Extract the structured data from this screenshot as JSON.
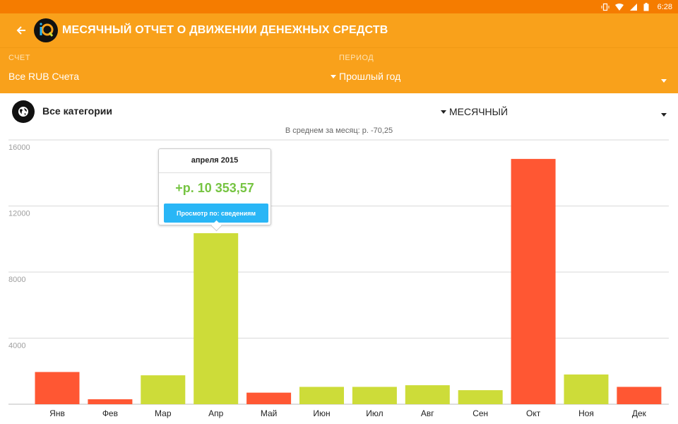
{
  "status_bar": {
    "time": "6:28"
  },
  "app_bar": {
    "title": "МЕСЯЧНЫЙ ОТЧЕТ О ДВИЖЕНИИ ДЕНЕЖНЫХ СРЕДСТВ"
  },
  "filters": {
    "account_label": "СЧЕТ",
    "account_value": "Все RUB Счета",
    "period_label": "ПЕРИОД",
    "period_value": "Прошлый год"
  },
  "category": {
    "label": "Все категории",
    "grouping": "МЕСЯЧНЫЙ"
  },
  "average_text": "В среднем за месяц: р. -70,25",
  "tooltip": {
    "title": "апреля 2015",
    "amount": "+р. 10 353,57",
    "button": "Просмотр по: сведениям"
  },
  "colors": {
    "positive": "#cddc39",
    "negative": "#ff5733",
    "accent": "#f9a11b",
    "button": "#29b6f6"
  },
  "chart_data": {
    "type": "bar",
    "categories": [
      "Янв",
      "Фев",
      "Мар",
      "Апр",
      "Май",
      "Июн",
      "Июл",
      "Авг",
      "Сен",
      "Окт",
      "Ноя",
      "Дек"
    ],
    "values": [
      1950,
      300,
      1750,
      10354,
      700,
      1050,
      1050,
      1150,
      850,
      14850,
      1800,
      1050
    ],
    "sign": [
      "negative",
      "negative",
      "positive",
      "positive",
      "negative",
      "positive",
      "positive",
      "positive",
      "positive",
      "negative",
      "positive",
      "negative"
    ],
    "y_ticks": [
      "16000",
      "12000",
      "8000",
      "4000"
    ],
    "ylim": [
      0,
      16000
    ],
    "grid": true
  }
}
